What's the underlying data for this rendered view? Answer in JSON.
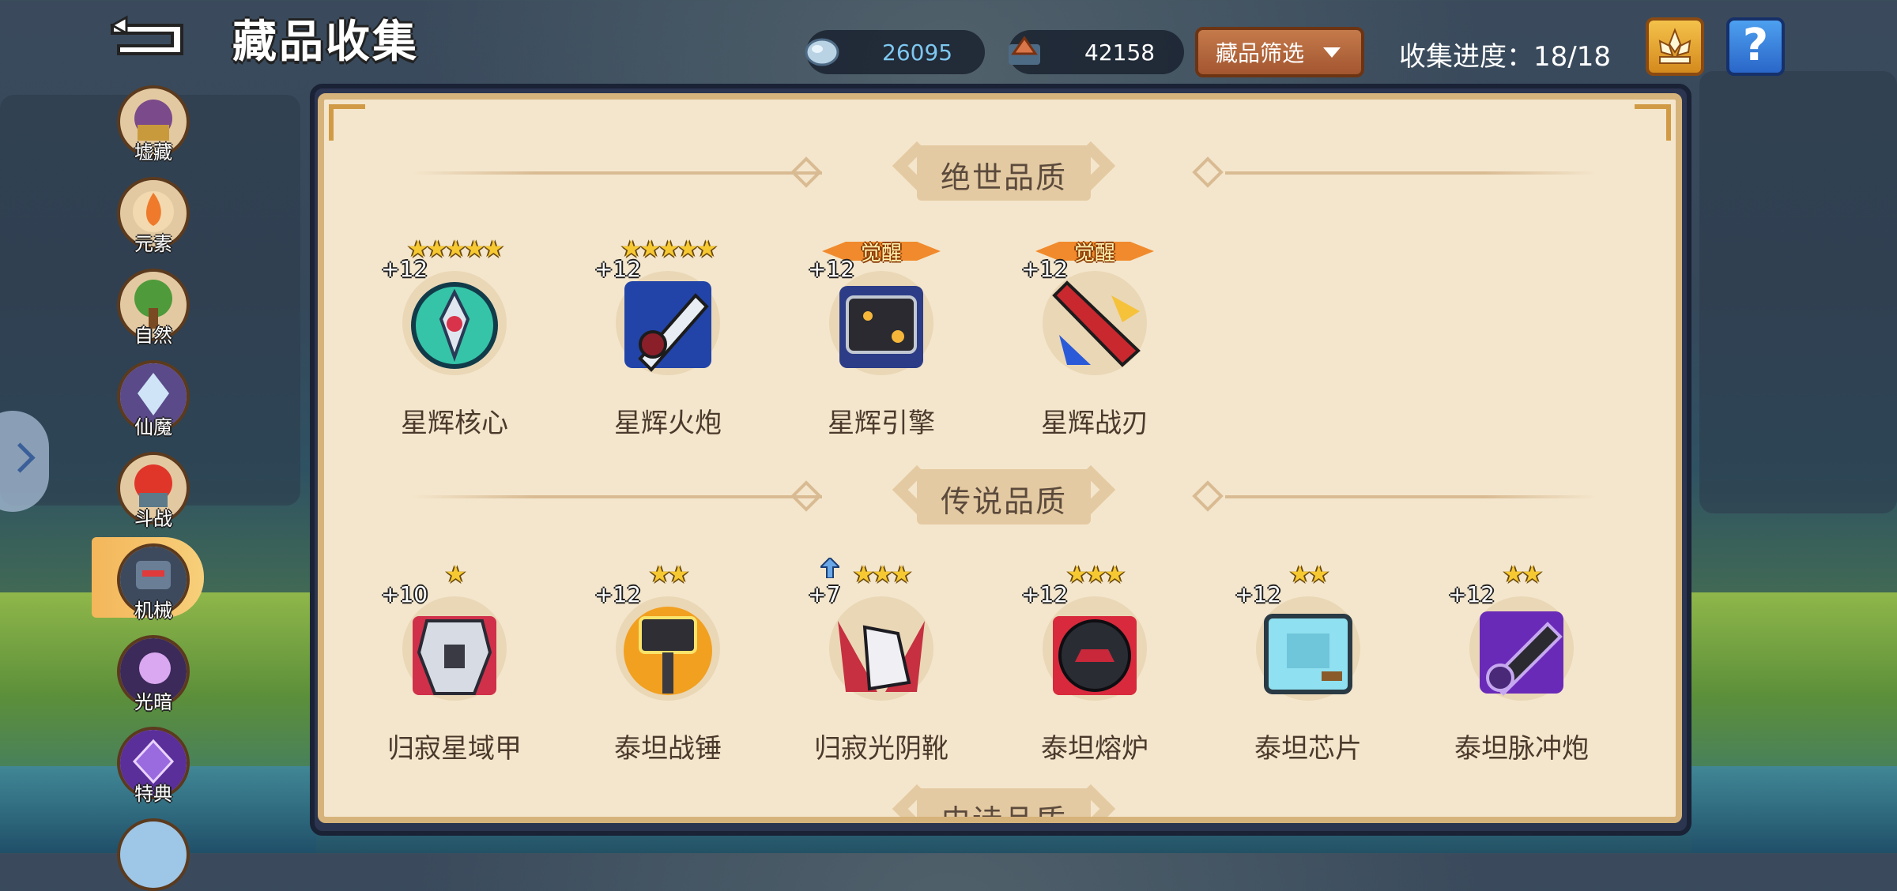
{
  "header": {
    "title": "藏品收集",
    "currency": [
      {
        "icon": "silver-ore-icon",
        "value": "26095",
        "color": "#7ec8f0"
      },
      {
        "icon": "copper-ore-icon",
        "value": "42158",
        "color": "#ffffff"
      }
    ],
    "filter_label": "藏品筛选",
    "progress": "收集进度：18/18"
  },
  "sidebar": {
    "items": [
      {
        "label": "墟藏",
        "icon": "ruins-treasure-icon"
      },
      {
        "label": "元素",
        "icon": "element-flame-icon"
      },
      {
        "label": "自然",
        "icon": "nature-tree-icon"
      },
      {
        "label": "仙魔",
        "icon": "immortal-demon-icon"
      },
      {
        "label": "斗战",
        "icon": "battle-fist-icon"
      },
      {
        "label": "机械",
        "icon": "mech-robot-icon",
        "active": true
      },
      {
        "label": "光暗",
        "icon": "light-dark-icon"
      },
      {
        "label": "特典",
        "icon": "special-book-icon"
      }
    ]
  },
  "sections": [
    {
      "title": "绝世品质",
      "items": [
        {
          "name": "星辉核心",
          "plus": "+12",
          "stars": "★★★★★",
          "awaken": ""
        },
        {
          "name": "星辉火炮",
          "plus": "+12",
          "stars": "★★★★★",
          "awaken": ""
        },
        {
          "name": "星辉引擎",
          "plus": "+12",
          "stars": "",
          "awaken": "觉醒"
        },
        {
          "name": "星辉战刃",
          "plus": "+12",
          "stars": "",
          "awaken": "觉醒"
        }
      ]
    },
    {
      "title": "传说品质",
      "items": [
        {
          "name": "归寂星域甲",
          "plus": "+10",
          "stars": "★"
        },
        {
          "name": "泰坦战锤",
          "plus": "+12",
          "stars": "★★"
        },
        {
          "name": "归寂光阴靴",
          "plus": "+7",
          "stars": "★★★"
        },
        {
          "name": "泰坦熔炉",
          "plus": "+12",
          "stars": "★★★"
        },
        {
          "name": "泰坦芯片",
          "plus": "+12",
          "stars": "★★"
        },
        {
          "name": "泰坦脉冲炮",
          "plus": "+12",
          "stars": "★★"
        }
      ]
    },
    {
      "title": "史诗品质"
    }
  ]
}
